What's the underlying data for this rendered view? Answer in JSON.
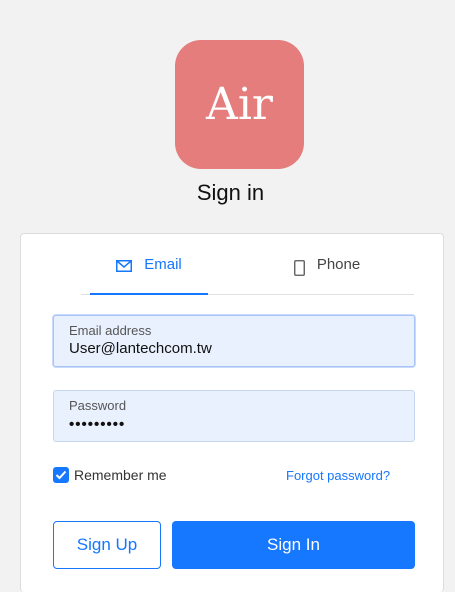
{
  "logo": {
    "text": "Air",
    "color": "#e57d7d"
  },
  "title": "Sign in",
  "tabs": [
    {
      "label": "Email",
      "icon": "mail-icon",
      "active": true
    },
    {
      "label": "Phone",
      "icon": "phone-icon",
      "active": false
    }
  ],
  "email_field": {
    "label": "Email address",
    "value": "User@lantechcom.tw"
  },
  "password_field": {
    "label": "Password",
    "value": "•••••••••"
  },
  "remember": {
    "label": "Remember me",
    "checked": true
  },
  "forgot_label": "Forgot password?",
  "buttons": {
    "signup": "Sign Up",
    "signin": "Sign In"
  },
  "colors": {
    "accent": "#1677ff",
    "field_bg": "#eaf1fe"
  }
}
